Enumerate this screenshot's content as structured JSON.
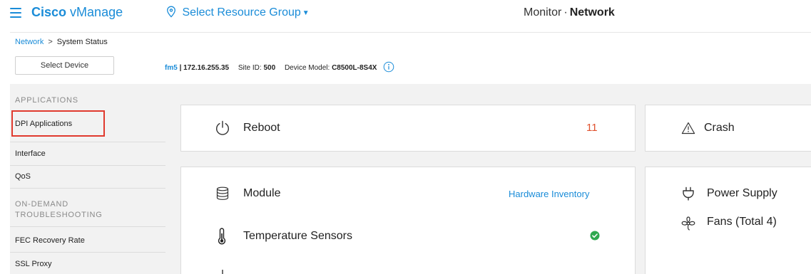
{
  "header": {
    "brand_bold": "Cisco",
    "brand_rest": "vManage",
    "resource_group": "Select Resource Group",
    "monitor": "Monitor",
    "dot": "·",
    "network": "Network"
  },
  "breadcrumb": {
    "link": "Network",
    "separator": ">",
    "current": "System Status"
  },
  "device": {
    "select_label": "Select Device",
    "hostname": "fm5",
    "ip_text": " | 172.16.255.35",
    "site_label": "Site ID: ",
    "site_id": "500",
    "model_label": "Device Model: ",
    "model": "C8500L-8S4X"
  },
  "sidebar": {
    "applications_heading": "APPLICATIONS",
    "items_top": [
      "DPI Applications",
      "Interface",
      "QoS"
    ],
    "on_demand_heading_1": "ON-DEMAND",
    "on_demand_heading_2": "TROUBLESHOOTING",
    "items_bottom": [
      "FEC Recovery Rate",
      "SSL Proxy"
    ],
    "highlighted_item": "DPI Applications"
  },
  "cards": {
    "reboot": {
      "label": "Reboot",
      "count": "11"
    },
    "crash": {
      "label": "Crash"
    },
    "module": {
      "label": "Module",
      "link": "Hardware Inventory"
    },
    "temperature": {
      "label": "Temperature Sensors",
      "status": "ok"
    },
    "power": {
      "label": "Power Supply"
    },
    "fans": {
      "label": "Fans (Total 4)"
    }
  },
  "colors": {
    "accent": "#1a8cd8",
    "highlight_box": "#e03a2e",
    "reboot_count": "#e0522e",
    "status_ok": "#2ea84f"
  },
  "icons": {
    "menu": "hamburger-icon",
    "location": "location-pin-icon",
    "info": "info-icon",
    "reboot": "power-icon",
    "crash": "warning-icon",
    "module": "database-stack-icon",
    "temperature": "thermometer-icon",
    "power": "plug-icon",
    "fans": "fan-icon",
    "status": "check-circle-icon"
  }
}
